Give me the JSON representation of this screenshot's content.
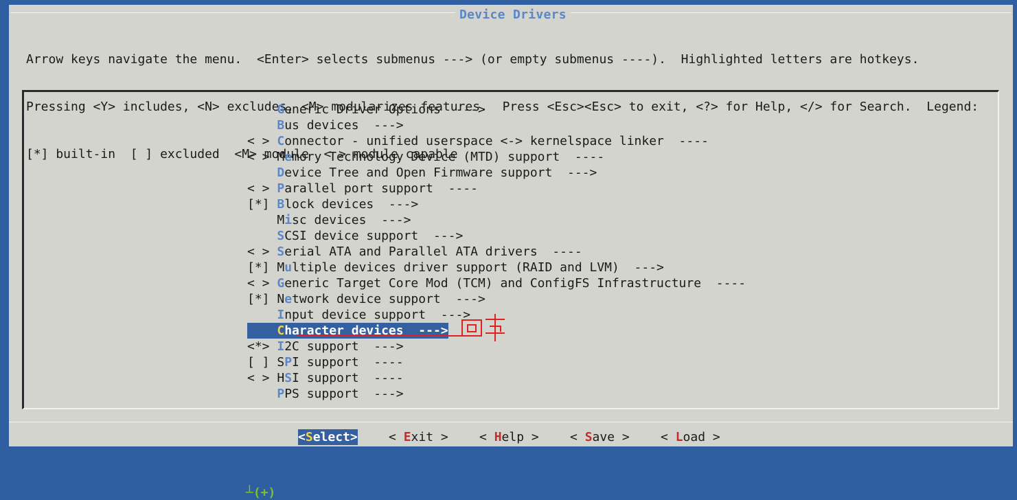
{
  "title": "Device Drivers",
  "help_lines": [
    "Arrow keys navigate the menu.  <Enter> selects submenus ---> (or empty submenus ----).  Highlighted letters are hotkeys.",
    "Pressing <Y> includes, <N> excludes, <M> modularizes features.  Press <Esc><Esc> to exit, <?> for Help, </> for Search.  Legend:",
    "[*] built-in  [ ] excluded  <M> module  < > module capable"
  ],
  "menu_items": [
    {
      "prefix": "    ",
      "hotkey": "G",
      "rest": "eneric Driver Options  --->",
      "selected": false
    },
    {
      "prefix": "    ",
      "hotkey": "B",
      "rest": "us devices  --->",
      "selected": false
    },
    {
      "prefix": "< > ",
      "hotkey": "C",
      "rest": "onnector - unified userspace <-> kernelspace linker  ----",
      "selected": false
    },
    {
      "prefix": "< > M",
      "hotkey": "e",
      "rest": "mory Technology Device (MTD) support  ----",
      "selected": false
    },
    {
      "prefix": "    ",
      "hotkey": "D",
      "rest": "evice Tree and Open Firmware support  --->",
      "selected": false
    },
    {
      "prefix": "< > ",
      "hotkey": "P",
      "rest": "arallel port support  ----",
      "selected": false
    },
    {
      "prefix": "[*] ",
      "hotkey": "B",
      "rest": "lock devices  --->",
      "selected": false
    },
    {
      "prefix": "    M",
      "hotkey": "i",
      "rest": "sc devices  --->",
      "selected": false
    },
    {
      "prefix": "    ",
      "hotkey": "S",
      "rest": "CSI device support  --->",
      "selected": false
    },
    {
      "prefix": "< > ",
      "hotkey": "S",
      "rest": "erial ATA and Parallel ATA drivers  ----",
      "selected": false
    },
    {
      "prefix": "[*] M",
      "hotkey": "u",
      "rest": "ltiple devices driver support (RAID and LVM)  --->",
      "selected": false
    },
    {
      "prefix": "< > ",
      "hotkey": "G",
      "rest": "eneric Target Core Mod (TCM) and ConfigFS Infrastructure  ----",
      "selected": false
    },
    {
      "prefix": "[*] N",
      "hotkey": "e",
      "rest": "twork device support  --->",
      "selected": false
    },
    {
      "prefix": "    ",
      "hotkey": "I",
      "rest": "nput device support  --->",
      "selected": false
    },
    {
      "prefix": "    ",
      "hotkey": "C",
      "rest": "haracter devices  --->",
      "selected": true
    },
    {
      "prefix": "<*> ",
      "hotkey": "I",
      "rest": "2C support  --->",
      "selected": false
    },
    {
      "prefix": "[ ] S",
      "hotkey": "P",
      "rest": "I support  ----",
      "selected": false
    },
    {
      "prefix": "< > H",
      "hotkey": "S",
      "rest": "I support  ----",
      "selected": false
    },
    {
      "prefix": "    ",
      "hotkey": "P",
      "rest": "PS support  --->",
      "selected": false
    }
  ],
  "more_indicator": "┴(+)",
  "buttons": [
    {
      "pre": "<",
      "hotkey": "S",
      "post": "elect>",
      "active": true
    },
    {
      "pre": "< ",
      "hotkey": "E",
      "post": "xit >",
      "active": false
    },
    {
      "pre": "< ",
      "hotkey": "H",
      "post": "elp >",
      "active": false
    },
    {
      "pre": "< ",
      "hotkey": "S",
      "post": "ave >",
      "active": false
    },
    {
      "pre": "< ",
      "hotkey": "L",
      "post": "oad >",
      "active": false
    }
  ],
  "annotation_text": "回车",
  "colors": {
    "accent": "#5b87c7",
    "selection": "#3560a0",
    "hotkey_selected": "#f4d24a",
    "button_hotkey": "#c12d2d",
    "annotation": "#e02020",
    "more": "#7fc12a"
  }
}
